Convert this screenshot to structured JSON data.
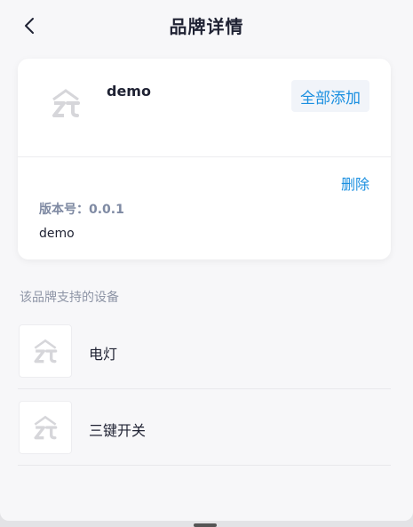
{
  "header": {
    "title": "品牌详情",
    "back_icon": "chevron-left-icon"
  },
  "brand": {
    "logo_icon": "zt-logo-icon",
    "name": "demo",
    "add_all_label": "全部添加",
    "delete_label": "删除",
    "version_label": "版本号：",
    "version_value": "0.0.1",
    "description": "demo"
  },
  "devices_section": {
    "title": "该品牌支持的设备",
    "items": [
      {
        "icon": "zt-logo-icon",
        "name": "电灯"
      },
      {
        "icon": "zt-logo-icon",
        "name": "三键开关"
      }
    ]
  },
  "colors": {
    "accent": "#1a8fe0",
    "title_text": "#1f2233",
    "muted_text": "#8e95a6",
    "card_bg": "#ffffff",
    "page_bg": "#f7f7f9"
  }
}
